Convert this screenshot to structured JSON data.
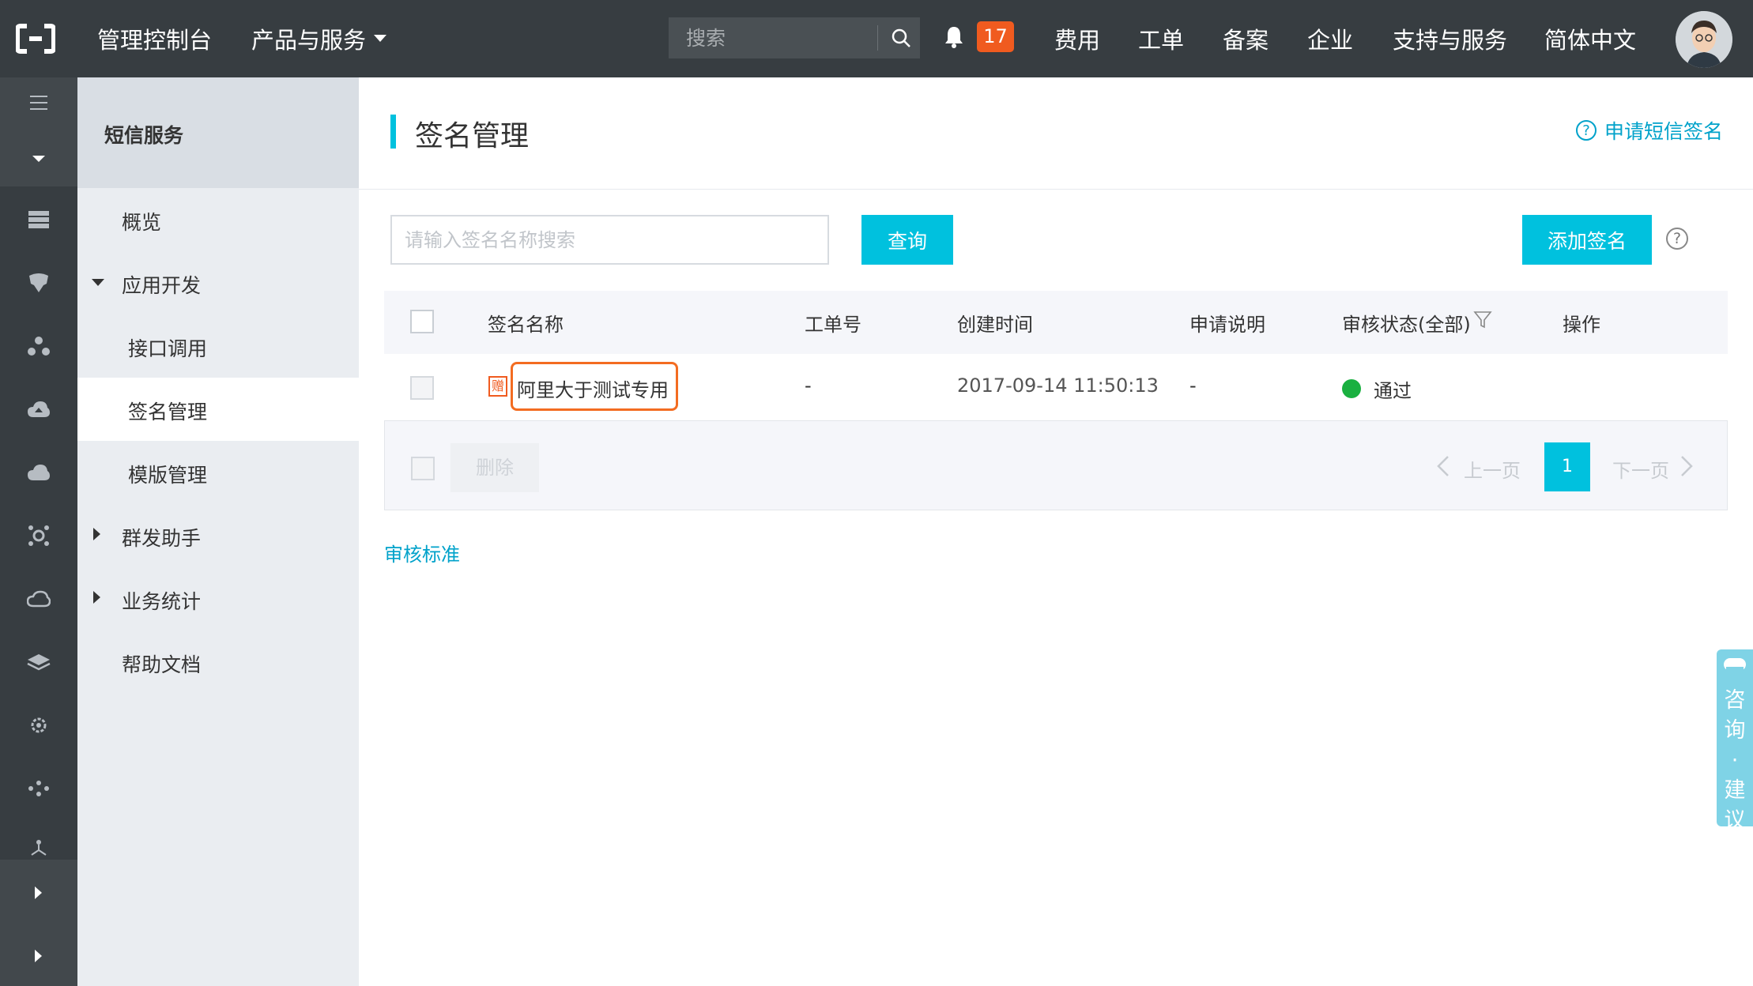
{
  "topbar": {
    "console": "管理控制台",
    "products": "产品与服务",
    "search_placeholder": "搜索",
    "notifications": "17",
    "nav": [
      "费用",
      "工单",
      "备案",
      "企业",
      "支持与服务",
      "简体中文"
    ]
  },
  "rail": {
    "icons": [
      "menu-icon",
      "chevron-down-icon",
      "server-icon",
      "database-icon",
      "network-icon",
      "cloud-upload-icon",
      "cloud-cluster-icon",
      "hub-icon",
      "cloud-icon",
      "layers-icon",
      "gear-icon",
      "nodes-icon",
      "tree-icon",
      "chevron-right-icon",
      "chevron-right-icon"
    ]
  },
  "subnav": {
    "title": "短信服务",
    "items": {
      "overview": "概览",
      "app_dev": "应用开发",
      "api_call": "接口调用",
      "signature": "签名管理",
      "template": "模版管理",
      "mass_send": "群发助手",
      "stats": "业务统计",
      "help_docs": "帮助文档"
    }
  },
  "main": {
    "title": "签名管理",
    "apply_link": "申请短信签名",
    "filter_placeholder": "请输入签名名称搜索",
    "query_button": "查询",
    "add_button": "添加签名",
    "columns": [
      "签名名称",
      "工单号",
      "创建时间",
      "申请说明",
      "审核状态(全部)",
      "操作"
    ],
    "rows": [
      {
        "gift_badge": "赠",
        "name": "阿里大于测试专用",
        "ticket": "-",
        "created": "2017-09-14 11:50:13",
        "note": "-",
        "status": "通过"
      }
    ],
    "delete_button": "删除",
    "prev_page": "上一页",
    "current_page": "1",
    "next_page": "下一页",
    "review_link": "审核标准"
  },
  "consult": {
    "text": "咨\n询\n·\n建\n议"
  },
  "colors": {
    "topbar": "#373d41",
    "accent": "#00c1de",
    "link": "#00a2ca",
    "badge": "#f05b1f",
    "status_ok": "#1ab040"
  }
}
